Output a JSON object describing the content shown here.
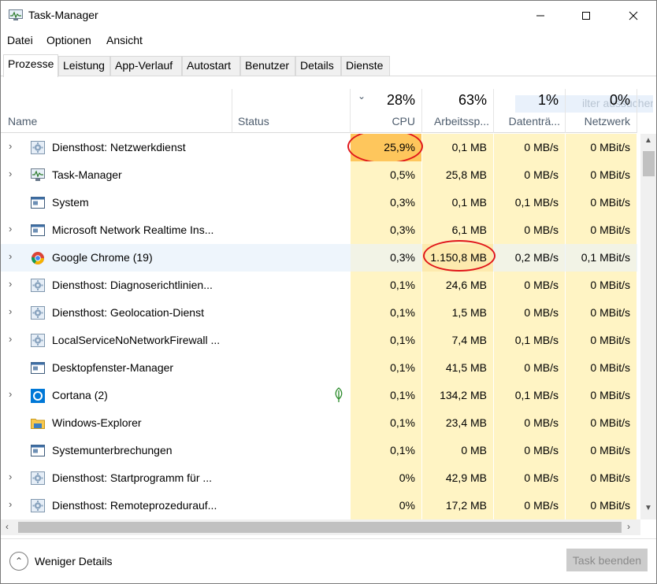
{
  "window": {
    "title": "Task-Manager"
  },
  "menu": [
    "Datei",
    "Optionen",
    "Ansicht"
  ],
  "tabs": [
    {
      "label": "Prozesse",
      "active": true
    },
    {
      "label": "Leistung"
    },
    {
      "label": "App-Verlauf"
    },
    {
      "label": "Autostart"
    },
    {
      "label": "Benutzer"
    },
    {
      "label": "Details"
    },
    {
      "label": "Dienste"
    }
  ],
  "search": {
    "ghost_text": "ilter aussuchen"
  },
  "columns": {
    "name": "Name",
    "status": "Status",
    "cpu": {
      "pct": "28%",
      "label": "CPU"
    },
    "memory": {
      "pct": "63%",
      "label": "Arbeitssp..."
    },
    "disk": {
      "pct": "1%",
      "label": "Datenträ..."
    },
    "network": {
      "pct": "0%",
      "label": "Netzwerk"
    }
  },
  "colors": {
    "heat_low": "#fff4c4",
    "heat_mid": "#fdeaae",
    "heat_high": "#fec65c",
    "annotation": "#e0161a",
    "selected_row": "#eef5fc"
  },
  "processes": [
    {
      "name": "Diensthost: Netzwerkdienst",
      "icon": "gear-service-icon",
      "expandable": true,
      "cpu": "25,9%",
      "memory": "0,1 MB",
      "disk": "0 MB/s",
      "network": "0 MBit/s",
      "cpu_heat": "high",
      "annotated": "cpu"
    },
    {
      "name": "Task-Manager",
      "icon": "task-manager-icon",
      "expandable": true,
      "cpu": "0,5%",
      "memory": "25,8 MB",
      "disk": "0 MB/s",
      "network": "0 MBit/s"
    },
    {
      "name": "System",
      "icon": "system-window-icon",
      "expandable": false,
      "cpu": "0,3%",
      "memory": "0,1 MB",
      "disk": "0,1 MB/s",
      "network": "0 MBit/s"
    },
    {
      "name": "Microsoft Network Realtime Ins...",
      "icon": "system-window-icon",
      "expandable": true,
      "cpu": "0,3%",
      "memory": "6,1 MB",
      "disk": "0 MB/s",
      "network": "0 MBit/s"
    },
    {
      "name": "Google Chrome (19)",
      "icon": "chrome-icon",
      "expandable": true,
      "cpu": "0,3%",
      "memory": "1.150,8 MB",
      "disk": "0,2 MB/s",
      "network": "0,1 MBit/s",
      "selected": true,
      "annotated": "memory"
    },
    {
      "name": "Diensthost: Diagnoserichtlinien...",
      "icon": "gear-service-icon",
      "expandable": true,
      "cpu": "0,1%",
      "memory": "24,6 MB",
      "disk": "0 MB/s",
      "network": "0 MBit/s"
    },
    {
      "name": "Diensthost: Geolocation-Dienst",
      "icon": "gear-service-icon",
      "expandable": true,
      "cpu": "0,1%",
      "memory": "1,5 MB",
      "disk": "0 MB/s",
      "network": "0 MBit/s"
    },
    {
      "name": "LocalServiceNoNetworkFirewall ...",
      "icon": "gear-service-icon",
      "expandable": true,
      "cpu": "0,1%",
      "memory": "7,4 MB",
      "disk": "0,1 MB/s",
      "network": "0 MBit/s"
    },
    {
      "name": "Desktopfenster-Manager",
      "icon": "system-window-icon",
      "expandable": false,
      "cpu": "0,1%",
      "memory": "41,5 MB",
      "disk": "0 MB/s",
      "network": "0 MBit/s"
    },
    {
      "name": "Cortana (2)",
      "icon": "cortana-icon",
      "expandable": true,
      "cpu": "0,1%",
      "memory": "134,2 MB",
      "disk": "0,1 MB/s",
      "network": "0 MBit/s",
      "status_icon": "leaf-icon"
    },
    {
      "name": "Windows-Explorer",
      "icon": "folder-icon",
      "expandable": false,
      "cpu": "0,1%",
      "memory": "23,4 MB",
      "disk": "0 MB/s",
      "network": "0 MBit/s"
    },
    {
      "name": "Systemunterbrechungen",
      "icon": "system-window-icon",
      "expandable": false,
      "cpu": "0,1%",
      "memory": "0 MB",
      "disk": "0 MB/s",
      "network": "0 MBit/s"
    },
    {
      "name": "Diensthost: Startprogramm für ...",
      "icon": "gear-service-icon",
      "expandable": true,
      "cpu": "0%",
      "memory": "42,9 MB",
      "disk": "0 MB/s",
      "network": "0 MBit/s"
    },
    {
      "name": "Diensthost: Remoteprozedurauf...",
      "icon": "gear-service-icon",
      "expandable": true,
      "cpu": "0%",
      "memory": "17,2 MB",
      "disk": "0 MB/s",
      "network": "0 MBit/s"
    }
  ],
  "footer": {
    "less_details": "Weniger Details",
    "end_task": "Task beenden"
  }
}
